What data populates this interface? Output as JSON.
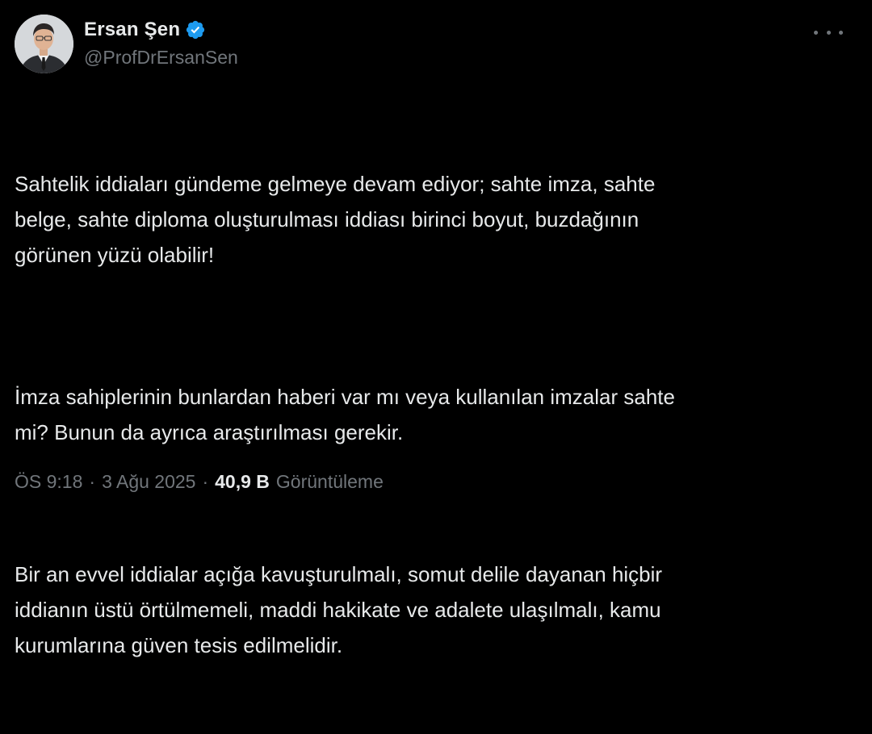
{
  "author": {
    "display_name": "Ersan Şen",
    "handle": "@ProfDrErsanSen",
    "verified": true,
    "verified_color": "#1d9bf0"
  },
  "icons": {
    "verified": "verified-badge-icon",
    "more": "more-horizontal-icon"
  },
  "tweet": {
    "paragraphs": [
      "Sahtelik iddiaları gündeme gelmeye devam ediyor; sahte imza, sahte\nbelge, sahte diploma oluşturulması iddiası birinci boyut, buzdağının\ngörünen yüzü olabilir!",
      "İmza sahiplerinin bunlardan haberi var mı veya kullanılan imzalar sahte\nmi? Bunun da ayrıca araştırılması gerekir.",
      "Bir an evvel iddialar açığa kavuşturulmalı, somut delile dayanan hiçbir\niddianın üstü örtülmemeli, maddi hakikate ve adalete ulaşılmalı, kamu\nkurumlarına güven tesis edilmelidir."
    ],
    "time": "ÖS 9:18",
    "date": "3 Ağu 2025",
    "separator": "·",
    "views_count": "40,9 B",
    "views_label": "Görüntüleme"
  },
  "colors": {
    "background": "#000000",
    "text_primary": "#e7e9ea",
    "text_secondary": "#71767b"
  }
}
